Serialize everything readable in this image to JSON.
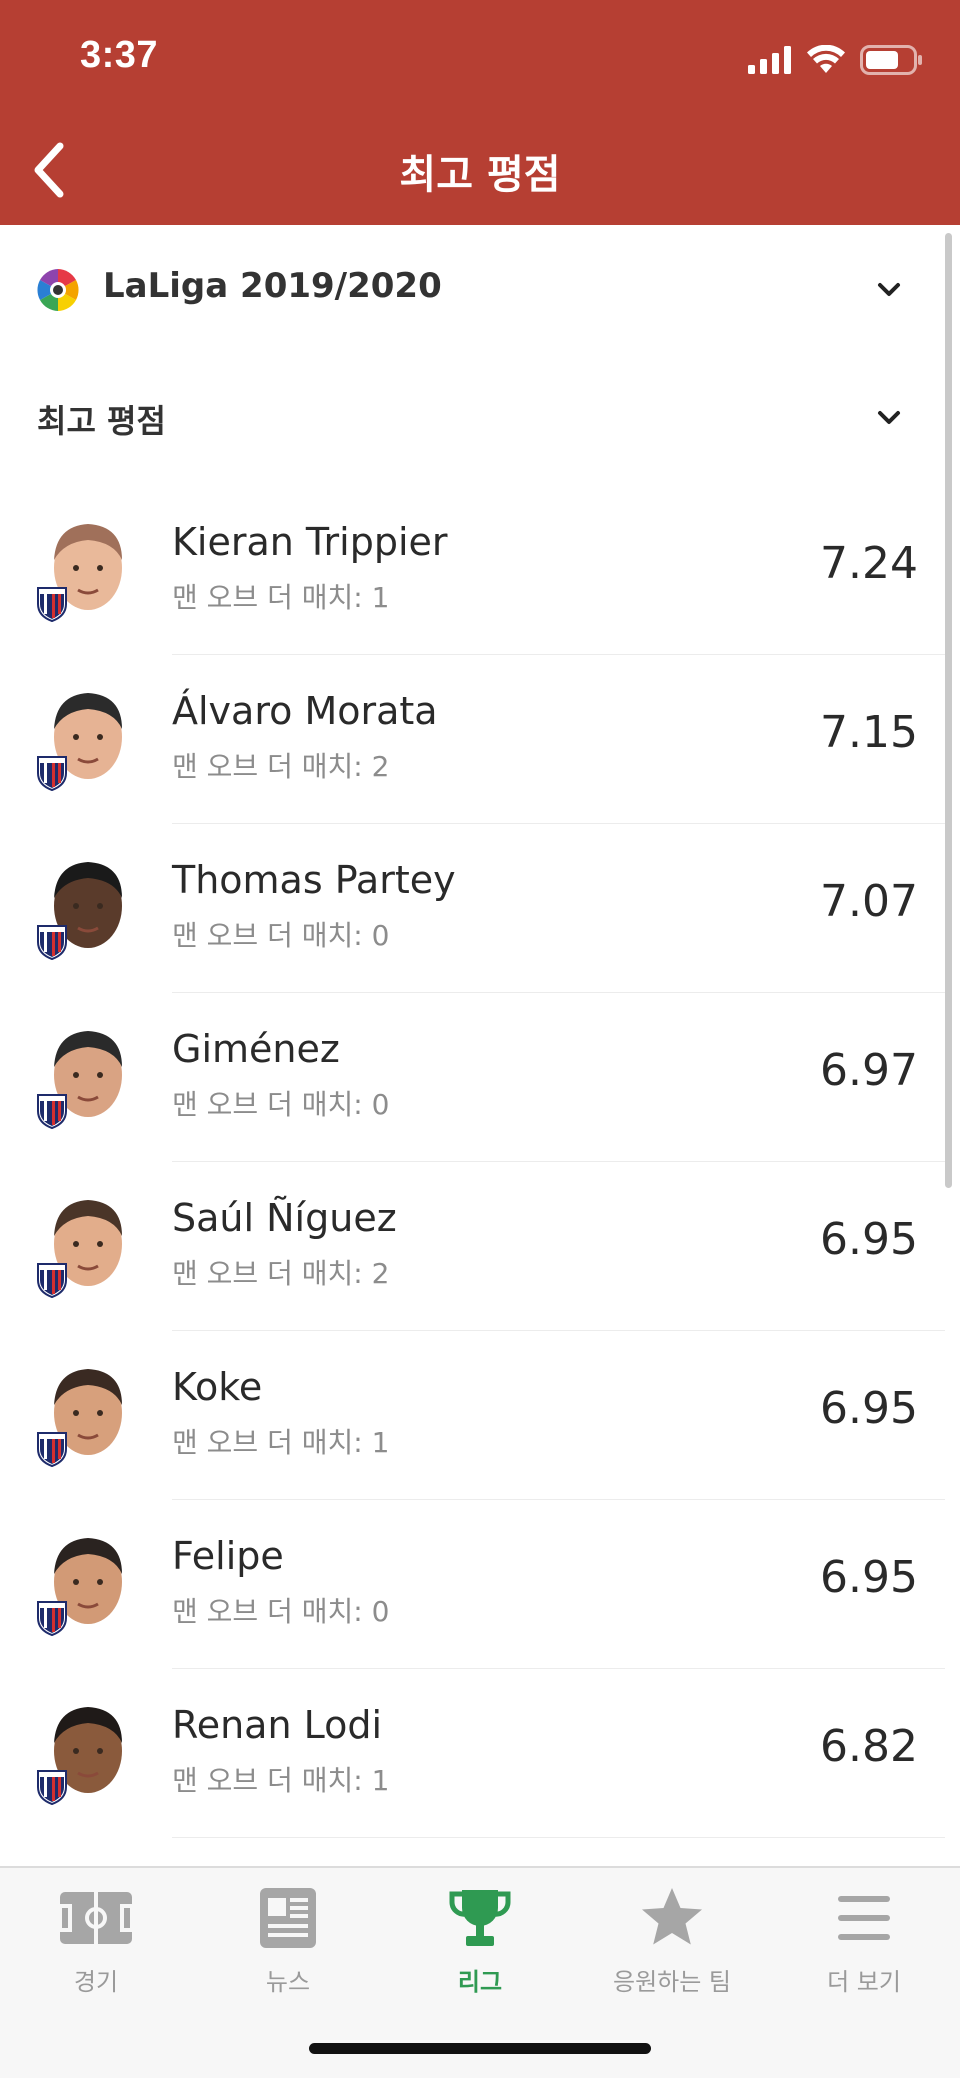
{
  "status_bar": {
    "time": "3:37"
  },
  "nav": {
    "title": "최고 평점",
    "back_icon": "chevron-left-icon"
  },
  "league_selector": {
    "label": "LaLiga 2019/2020",
    "icon": "laliga-logo"
  },
  "category_selector": {
    "label": "최고 평점"
  },
  "colors": {
    "header": "#b63f33",
    "active_tab": "#2f9a52",
    "inactive_tab": "#9a9a9a"
  },
  "players": [
    {
      "name": "Kieran Trippier",
      "motm": "맨 오브 더 매치: 1",
      "rating": "7.24"
    },
    {
      "name": "Álvaro Morata",
      "motm": "맨 오브 더 매치: 2",
      "rating": "7.15"
    },
    {
      "name": "Thomas Partey",
      "motm": "맨 오브 더 매치: 0",
      "rating": "7.07"
    },
    {
      "name": "Giménez",
      "motm": "맨 오브 더 매치: 0",
      "rating": "6.97"
    },
    {
      "name": "Saúl Ñíguez",
      "motm": "맨 오브 더 매치: 2",
      "rating": "6.95"
    },
    {
      "name": "Koke",
      "motm": "맨 오브 더 매치: 1",
      "rating": "6.95"
    },
    {
      "name": "Felipe",
      "motm": "맨 오브 더 매치: 0",
      "rating": "6.95"
    },
    {
      "name": "Renan Lodi",
      "motm": "맨 오브 더 매치: 1",
      "rating": "6.82"
    }
  ],
  "tabs": [
    {
      "label": "경기",
      "icon": "pitch-icon",
      "active": false
    },
    {
      "label": "뉴스",
      "icon": "news-icon",
      "active": false
    },
    {
      "label": "리그",
      "icon": "trophy-icon",
      "active": true
    },
    {
      "label": "응원하는 팀",
      "icon": "star-icon",
      "active": false
    },
    {
      "label": "더 보기",
      "icon": "menu-icon",
      "active": false
    }
  ]
}
